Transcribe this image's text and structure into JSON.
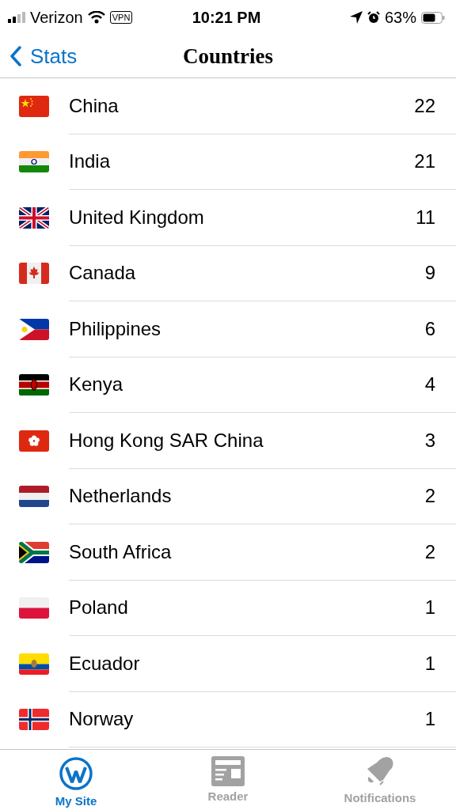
{
  "status_bar": {
    "carrier": "Verizon",
    "vpn": "VPN",
    "time": "10:21 PM",
    "battery": "63%"
  },
  "nav": {
    "back": "Stats",
    "title": "Countries"
  },
  "rows": [
    {
      "name": "China",
      "count": "22"
    },
    {
      "name": "India",
      "count": "21"
    },
    {
      "name": "United Kingdom",
      "count": "11"
    },
    {
      "name": "Canada",
      "count": "9"
    },
    {
      "name": "Philippines",
      "count": "6"
    },
    {
      "name": "Kenya",
      "count": "4"
    },
    {
      "name": "Hong Kong SAR China",
      "count": "3"
    },
    {
      "name": "Netherlands",
      "count": "2"
    },
    {
      "name": "South Africa",
      "count": "2"
    },
    {
      "name": "Poland",
      "count": "1"
    },
    {
      "name": "Ecuador",
      "count": "1"
    },
    {
      "name": "Norway",
      "count": "1"
    }
  ],
  "tabs": [
    {
      "label": "My Site",
      "kind": "site",
      "selected": true
    },
    {
      "label": "Reader",
      "kind": "reader",
      "selected": false
    },
    {
      "label": "Notifications",
      "kind": "notifications",
      "selected": false
    }
  ]
}
